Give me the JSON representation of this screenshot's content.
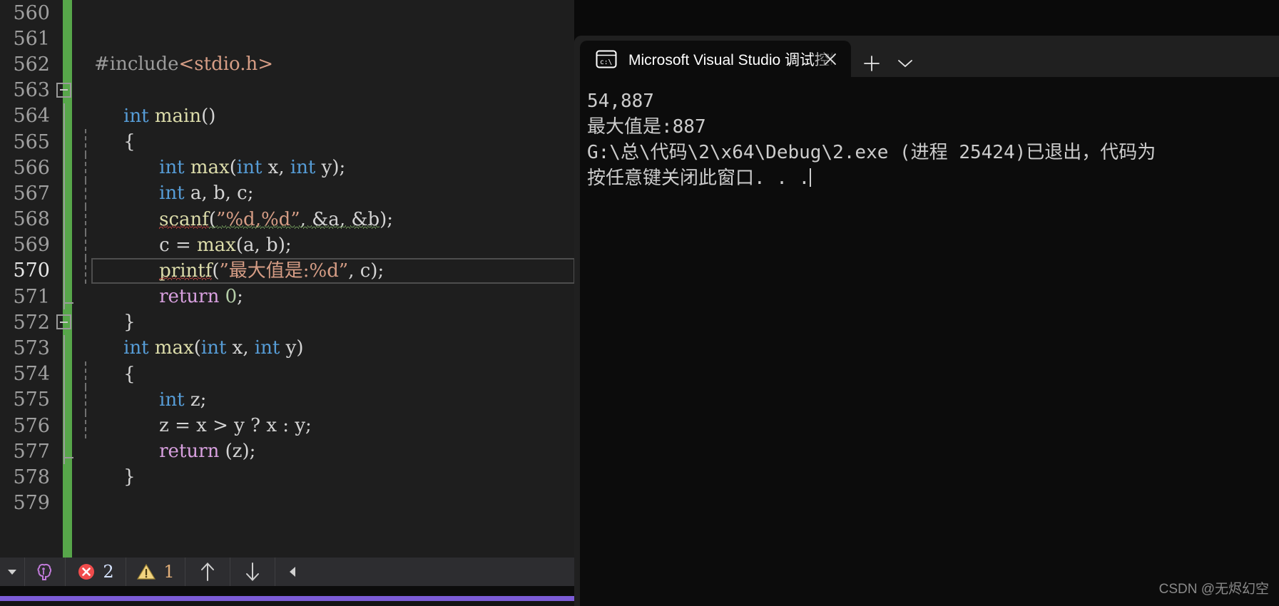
{
  "editor": {
    "change_bar_color": "#57a64a",
    "background": "#1e1e1e",
    "current_line": 570,
    "lines": [
      {
        "num": "560",
        "text": ""
      },
      {
        "num": "561",
        "text": ""
      },
      {
        "num": "562",
        "text": "#include<stdio.h>"
      },
      {
        "num": "563",
        "text": "int main()"
      },
      {
        "num": "564",
        "text": "{"
      },
      {
        "num": "565",
        "text": "    int max(int x, int y);"
      },
      {
        "num": "566",
        "text": "    int a, b, c;"
      },
      {
        "num": "567",
        "text": "    scanf(\"%d,%d\", &a, &b);"
      },
      {
        "num": "568",
        "text": "    c = max(a, b);"
      },
      {
        "num": "569",
        "text": "    printf(\"最大值是:%d\", c);"
      },
      {
        "num": "570",
        "text": "    return 0;"
      },
      {
        "num": "571",
        "text": "}"
      },
      {
        "num": "572",
        "text": "int max(int x, int y)"
      },
      {
        "num": "573",
        "text": "{"
      },
      {
        "num": "574",
        "text": "    int z;"
      },
      {
        "num": "575",
        "text": "    z = x > y ? x : y;"
      },
      {
        "num": "576",
        "text": "    return (z);"
      },
      {
        "num": "577",
        "text": "}"
      },
      {
        "num": "578",
        "text": ""
      },
      {
        "num": "579",
        "text": ""
      }
    ]
  },
  "status_bar": {
    "expand_icon": "chevron-down-icon",
    "intellicode_icon": "intellicode-brain-icon",
    "error_icon": "error-circle-icon",
    "error_count": "2",
    "warning_icon": "warning-triangle-icon",
    "warning_count": "1",
    "prev_icon": "arrow-up-icon",
    "next_icon": "arrow-down-icon",
    "collapse_icon": "arrow-left-icon",
    "error_color": "#f14c4c",
    "warning_color": "#f2d480",
    "accent_color": "#7c5cd6"
  },
  "console": {
    "tab": {
      "icon": "cmd-prompt-icon",
      "title": "Microsoft Visual Studio 调试控制台",
      "close_label": "✕"
    },
    "new_tab_label": "+",
    "dropdown_label": "⌄",
    "output_lines": [
      "54,887",
      "最大值是:887",
      "G:\\总\\代码\\2\\x64\\Debug\\2.exe (进程 25424)已退出，代码为",
      "按任意键关闭此窗口. . ."
    ]
  },
  "watermark": {
    "text": "CSDN @无烬幻空"
  }
}
